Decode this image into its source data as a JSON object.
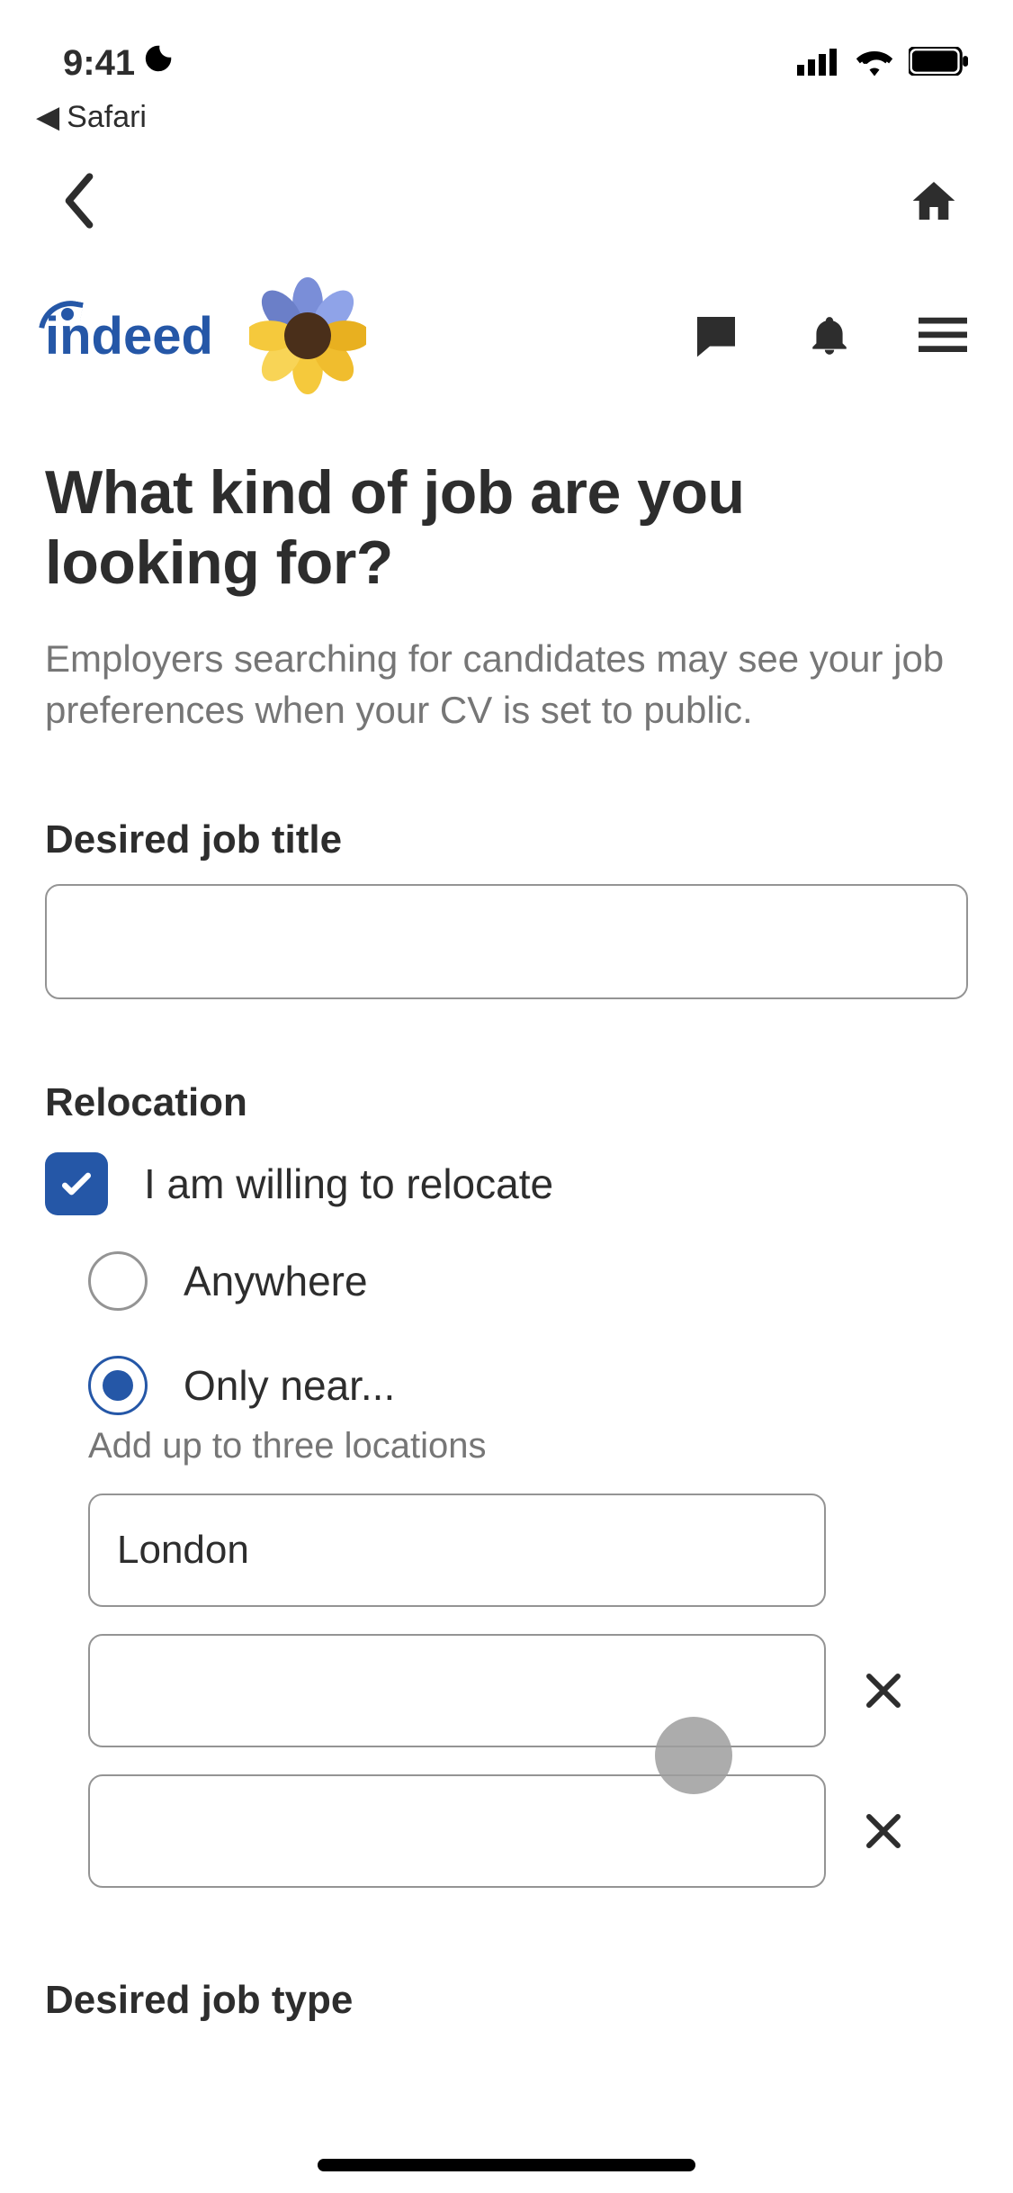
{
  "status": {
    "time": "9:41",
    "back_app": "Safari"
  },
  "header": {
    "brand": "indeed"
  },
  "page": {
    "title": "What kind of job are you looking for?",
    "subtitle": "Employers searching for candidates may see your job preferences when your CV is set to public."
  },
  "job_title_section": {
    "label": "Desired job title",
    "value": ""
  },
  "relocation": {
    "label": "Relocation",
    "checkbox_label": "I am willing to relocate",
    "checkbox_checked": true,
    "options": {
      "anywhere": {
        "label": "Anywhere",
        "selected": false
      },
      "only_near": {
        "label": "Only near...",
        "selected": true,
        "hint": "Add up to three locations"
      }
    },
    "locations": [
      "London",
      "",
      ""
    ]
  },
  "job_type_section": {
    "label": "Desired job type"
  }
}
